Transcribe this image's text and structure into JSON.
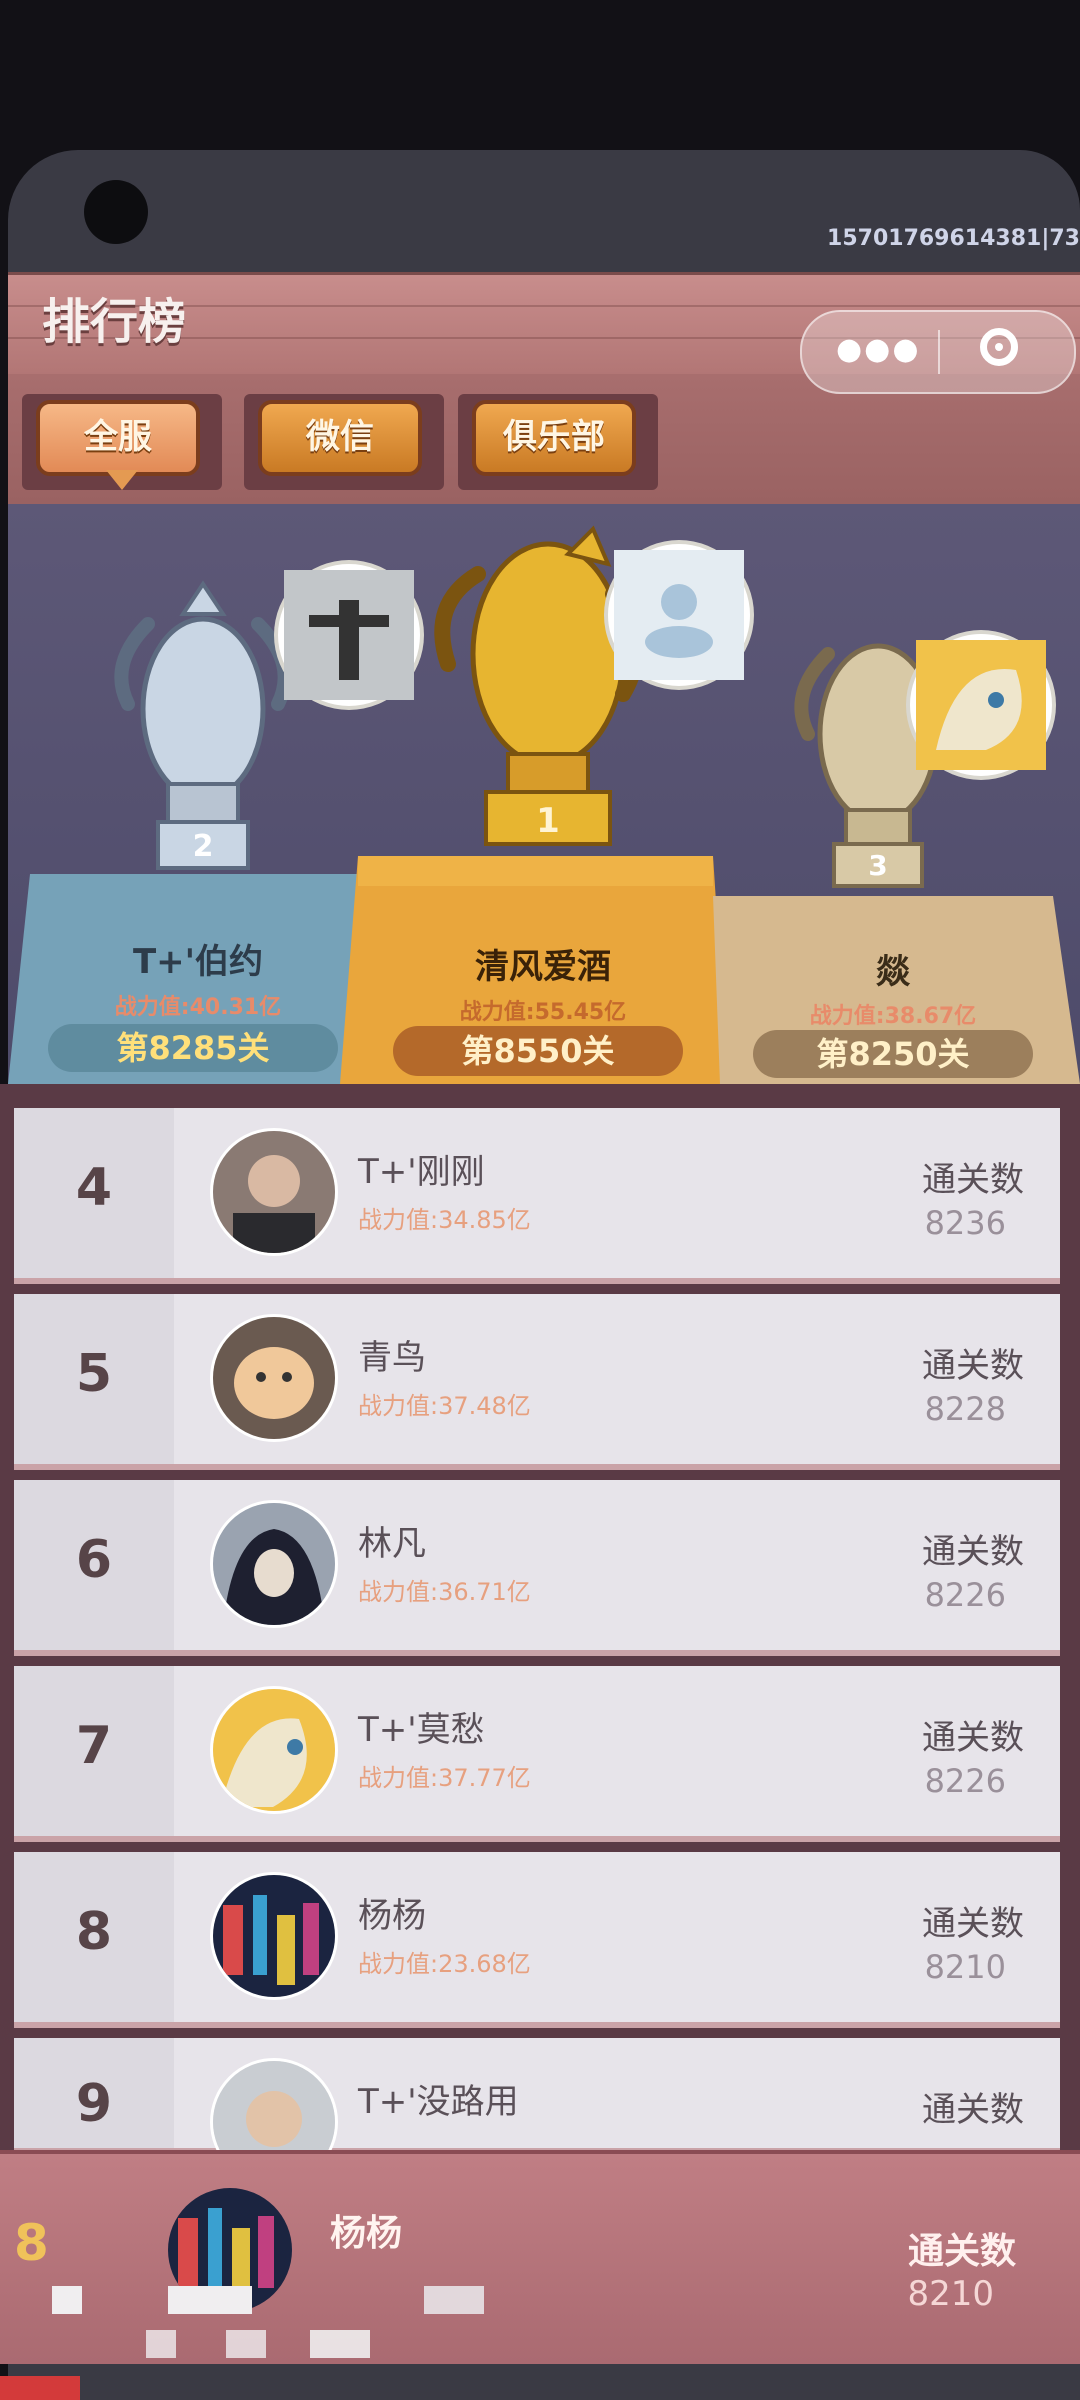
{
  "status": {
    "text": "15701769614381|73"
  },
  "header": {
    "title": "排行榜"
  },
  "tabs": [
    {
      "label": "全服",
      "active": true
    },
    {
      "label": "微信",
      "active": false
    },
    {
      "label": "俱乐部",
      "active": false
    }
  ],
  "podium": {
    "first": {
      "rank": "1",
      "name": "清风爱酒",
      "power": "战力值:55.45亿",
      "level": "第8550关"
    },
    "second": {
      "rank": "2",
      "name": "T+'伯约",
      "power": "战力值:40.31亿",
      "level": "第8285关"
    },
    "third": {
      "rank": "3",
      "name": "燚",
      "power": "战力值:38.67亿",
      "level": "第8250关"
    }
  },
  "list": [
    {
      "rank": "4",
      "name": "T+'刚刚",
      "power": "战力值:34.85亿",
      "label": "通关数",
      "value": "8236"
    },
    {
      "rank": "5",
      "name": "青鸟",
      "power": "战力值:37.48亿",
      "label": "通关数",
      "value": "8228"
    },
    {
      "rank": "6",
      "name": "林凡",
      "power": "战力值:36.71亿",
      "label": "通关数",
      "value": "8226"
    },
    {
      "rank": "7",
      "name": "T+'莫愁",
      "power": "战力值:37.77亿",
      "label": "通关数",
      "value": "8226"
    },
    {
      "rank": "8",
      "name": "杨杨",
      "power": "战力值:23.68亿",
      "label": "通关数",
      "value": "8210"
    },
    {
      "rank": "9",
      "name": "T+'没路用",
      "power": "",
      "label": "通关数",
      "value": ""
    }
  ],
  "mine": {
    "rank": "8",
    "name": "杨杨",
    "label": "通关数",
    "value": "8210"
  },
  "colors": {
    "gold": "#e9a63c",
    "silver": "#7fb0c8",
    "bronze": "#d6b98f",
    "wood": "#b27675",
    "accent": "#e7a07f"
  }
}
